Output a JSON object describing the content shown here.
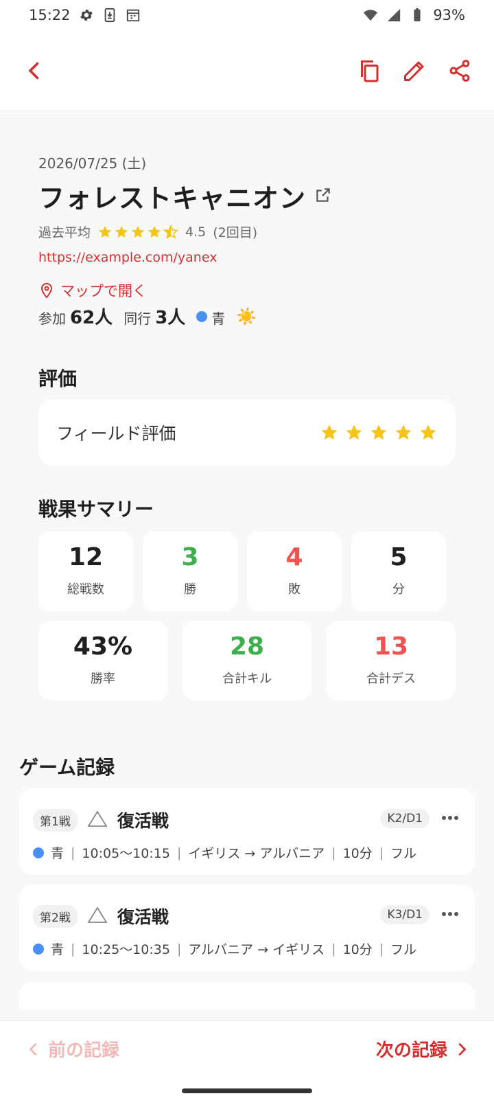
{
  "status_bar": {
    "time": "15:22",
    "battery": "93%",
    "icons_left": [
      "gear-icon",
      "download-icon",
      "calendar-icon"
    ],
    "icons_right": [
      "wifi-icon",
      "signal-icon",
      "battery-icon"
    ]
  },
  "app_bar": {
    "icons": [
      "back-icon",
      "copy-icon",
      "edit-icon",
      "share-icon"
    ],
    "accent_color": "#d32f2f"
  },
  "record": {
    "date": "2026/07/25 (土)",
    "title": "フォレストキャニオン",
    "avg_label": "過去平均",
    "avg_stars": 4.5,
    "avg_value": "4.5",
    "visit_count": "(2回目)",
    "url": "https://example.com/yanex",
    "map_label": "マップで開く",
    "participants_label": "参加",
    "participants_value": "62人",
    "companions_label": "同行",
    "companions_value": "3人",
    "team": "青",
    "team_color": "#4a90f2",
    "weather_icon": "sun-icon",
    "weather_glyph": "☀️"
  },
  "rating_section": {
    "title": "評価",
    "field_label": "フィールド評価",
    "field_stars": 5
  },
  "summary_section": {
    "title": "戦果サマリー",
    "stats_row1": [
      {
        "value": "12",
        "label": "総戦数",
        "color": "#1f1f1f"
      },
      {
        "value": "3",
        "label": "勝",
        "color": "#3fae4f"
      },
      {
        "value": "4",
        "label": "敗",
        "color": "#ef5350"
      },
      {
        "value": "5",
        "label": "分",
        "color": "#1f1f1f"
      }
    ],
    "stats_row2": [
      {
        "value": "43%",
        "label": "勝率",
        "color": "#1f1f1f"
      },
      {
        "value": "28",
        "label": "合計キル",
        "color": "#3fae4f"
      },
      {
        "value": "13",
        "label": "合計デス",
        "color": "#ef5350"
      }
    ]
  },
  "games_section": {
    "title": "ゲーム記録",
    "games": [
      {
        "badge": "第1戦",
        "result_icon": "triangle-icon",
        "name": "復活戦",
        "kd": "K2/D1",
        "team": "青",
        "time": "10:05〜10:15",
        "route": "イギリス → アルバニア",
        "duration": "10分",
        "mode": "フル"
      },
      {
        "badge": "第2戦",
        "result_icon": "triangle-icon",
        "name": "復活戦",
        "kd": "K3/D1",
        "team": "青",
        "time": "10:25〜10:35",
        "route": "アルバニア → イギリス",
        "duration": "10分",
        "mode": "フル"
      }
    ]
  },
  "bottom_nav": {
    "prev_label": "前の記録",
    "next_label": "次の記録"
  }
}
